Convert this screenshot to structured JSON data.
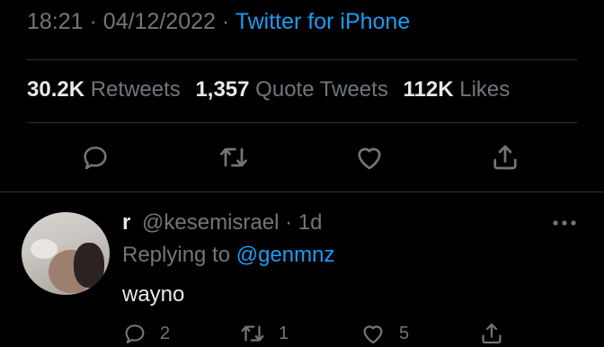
{
  "tweet": {
    "time": "18:21",
    "sep": "·",
    "date": "04/12/2022",
    "source": "Twitter for iPhone"
  },
  "stats": {
    "retweets_count": "30.2K",
    "retweets_label": "Retweets",
    "quotes_count": "1,357",
    "quotes_label": "Quote Tweets",
    "likes_count": "112K",
    "likes_label": "Likes"
  },
  "actions": [
    "reply-icon",
    "retweet-icon",
    "like-icon",
    "share-icon"
  ],
  "reply": {
    "name": "r",
    "handle": "@kesemisrael",
    "sep": "·",
    "age": "1d",
    "replying_prefix": "Replying to",
    "replying_to": "@genmnz",
    "text": "wayno",
    "reply_count": "2",
    "retweet_count": "1",
    "like_count": "5"
  },
  "colors": {
    "background": "#000000",
    "text": "#e7e9ea",
    "muted": "#71767b",
    "accent": "#1d9bf0",
    "divider": "#2f3336"
  }
}
